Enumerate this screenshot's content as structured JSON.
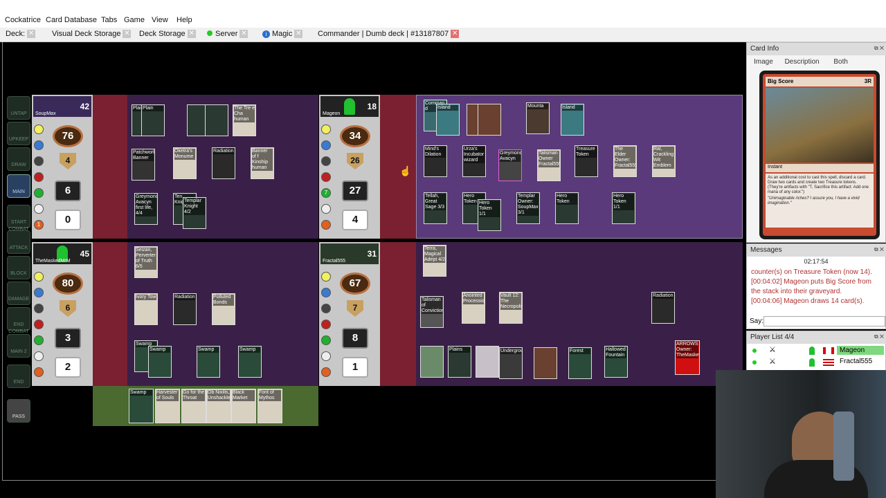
{
  "menu": [
    "Cockatrice",
    "Card Database",
    "Tabs",
    "Game",
    "View",
    "Help"
  ],
  "tabs": [
    {
      "label": "Deck:",
      "closable": true
    },
    {
      "label": "Visual Deck Storage",
      "closable": true
    },
    {
      "label": "Deck Storage",
      "closable": true
    },
    {
      "label": "Server",
      "closable": true,
      "icon": "green-dot-icon"
    },
    {
      "label": "Magic",
      "closable": true,
      "icon": "info-icon"
    },
    {
      "label": "Commander | Dumb deck | #13187807",
      "closable": true,
      "active": true
    }
  ],
  "phases": [
    "UNTAP",
    "UPKEEP",
    "DRAW",
    "MAIN",
    "START COMBAT",
    "ATTACK",
    "BLOCK",
    "DAMAGE",
    "END COMBAT",
    "MAIN 2",
    "END",
    "PASS"
  ],
  "players": [
    {
      "name": "SoupMax",
      "life": "42",
      "counters": [
        "76",
        "4",
        "6",
        "0"
      ]
    },
    {
      "name": "Mageon",
      "life": "18",
      "counters": [
        "34",
        "26",
        "27",
        "4"
      ]
    },
    {
      "name": "TheMaskedMrM",
      "life": "45",
      "counters": [
        "80",
        "6",
        "3",
        "2"
      ]
    },
    {
      "name": "Fractal555",
      "life": "31",
      "counters": [
        "67",
        "7",
        "8",
        "1"
      ]
    }
  ],
  "cards": {
    "soupmax": [
      "Plain",
      "Plain",
      "The Tre e Cha human",
      "Patchwork Banner",
      "Oketra's Monume",
      "Radiation",
      "Banner of f Kinship human",
      "Greymond, Avacyn first life, 4/4",
      "Ten Knight",
      "Templar Knight 4/2"
    ],
    "mageon": [
      "Comman d",
      "Island",
      "Mounta",
      "Island",
      "Mind's Dilation",
      "Urza's Incubator wizard",
      "Greymond Avacyn",
      "Talisman Owner Fractal555",
      "Treasure Token",
      "The Elder Owner: Fractal555",
      "Ral, Crackling Wit Emblem",
      "Tellah, Great Sage 3/3",
      "Hero Token",
      "Hero Token 1/1",
      "Templar Owner: SoupMax 3/1",
      "Hero Token",
      "Hero Token 1/1"
    ],
    "masked": [
      "Seizan, Perverter of Truth 6/5",
      "Ivory Tow",
      "Radiation",
      "Polluted Bonds",
      "Swamp",
      "Swamp",
      "Swamp",
      "Swamp",
      "Sanguine",
      "Ghost Qu"
    ],
    "fractal": [
      "Terra, Magical Adept 4/2",
      "Talisman of Conviction",
      "Anointed Procession",
      "Vault 12: The Necropolis",
      "Radiation",
      "Plains",
      "Underground",
      "Forest",
      "Hallowed Fountain",
      "ARROWS Owner: TheMaskedMrM"
    ],
    "hand": [
      "Swamp",
      "Harvester of Souls",
      "Go for the Throat",
      "Ob Nixilis, Unshackled",
      "Black Market",
      "Font of Mythos"
    ]
  },
  "card_info": {
    "title": "Card Info",
    "tabs": [
      "Image",
      "Description",
      "Both"
    ],
    "card_name": "Big Score",
    "cost": "3R",
    "type": "Instant",
    "rules": "As an additional cost to cast this spell, discard a card. Draw two cards and create two Treasure tokens. (They're artifacts with \"T, Sacrifice this artifact: Add one mana of any color.\")",
    "flavor": "\"Unimaginable riches? I assure you, I have a vivid imagination.\""
  },
  "messages": {
    "title": "Messages",
    "time": "02:17:54",
    "lines": [
      "counter(s) on Treasure Token (now 14).",
      "[00:04:02] Mageon puts Big Score from the stack into their graveyard.",
      "[00:04:06] Mageon draws 14 card(s)."
    ],
    "say_label": "Say:"
  },
  "player_list": {
    "title": "Player List 4/4",
    "players": [
      {
        "name": "Mageon",
        "flag": "Canada"
      },
      {
        "name": "Fractal555",
        "flag": "USA"
      }
    ]
  }
}
